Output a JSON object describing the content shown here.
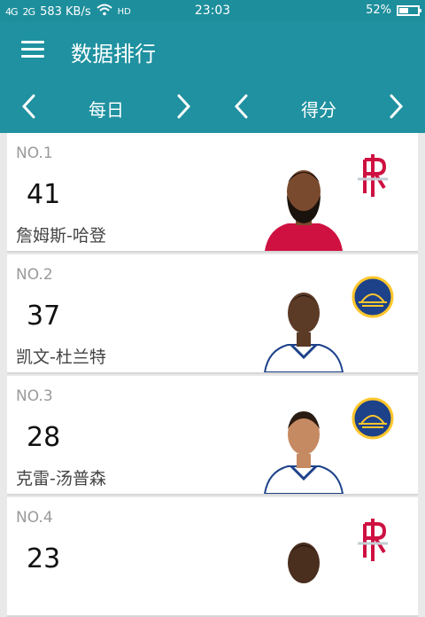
{
  "status_bar": {
    "signal_1": "4G",
    "signal_2": "2G",
    "network_speed": "583 KB/s",
    "wifi_icon": "wifi-icon",
    "hd": "HD",
    "time": "23:03",
    "battery_percent": "52%",
    "battery_level": 0.52
  },
  "app_bar": {
    "menu_icon": "hamburger-menu-icon",
    "title": "数据排行"
  },
  "filters": {
    "period": {
      "label": "每日"
    },
    "stat": {
      "label": "得分"
    }
  },
  "rankings": [
    {
      "rank": "NO.1",
      "score": "41",
      "name": "詹姆斯-哈登",
      "team": "rockets",
      "team_color": "#ce1141",
      "jersey_color": "#ce1141"
    },
    {
      "rank": "NO.2",
      "score": "37",
      "name": "凯文-杜兰特",
      "team": "warriors",
      "team_color": "#1d428a",
      "jersey_color": "#ffffff"
    },
    {
      "rank": "NO.3",
      "score": "28",
      "name": "克雷-汤普森",
      "team": "warriors",
      "team_color": "#1d428a",
      "jersey_color": "#ffffff"
    },
    {
      "rank": "NO.4",
      "score": "23",
      "name": "",
      "team": "rockets",
      "team_color": "#ce1141",
      "jersey_color": "#ce1141"
    }
  ],
  "colors": {
    "header": "#1f91a0",
    "status": "#1d8e9c",
    "accent_red": "#ce1141",
    "warriors_blue": "#1d428a",
    "warriors_gold": "#ffc72c"
  }
}
